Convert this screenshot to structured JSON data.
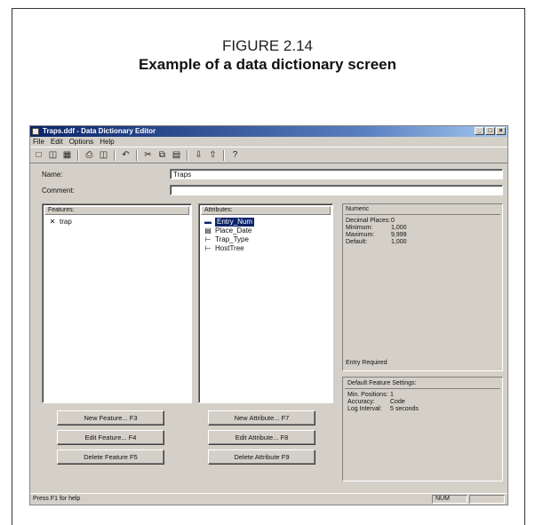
{
  "figure": {
    "number": "FIGURE 2.14",
    "title": "Example of a data dictionary screen"
  },
  "window": {
    "title": "Traps.ddf - Data Dictionary Editor",
    "controls": {
      "minimize": "_",
      "maximize": "□",
      "close": "×"
    }
  },
  "menu": [
    "File",
    "Edit",
    "Options",
    "Help"
  ],
  "toolbar": {
    "icons": [
      "new-file-icon",
      "open-folder-icon",
      "save-icon",
      "print-icon",
      "print-preview-icon",
      "undo-icon",
      "cut-icon",
      "copy-icon",
      "paste-icon",
      "move-down-icon",
      "move-up-icon",
      "help-icon"
    ]
  },
  "form": {
    "name_label": "Name:",
    "name_value": "Traps",
    "comment_label": "Comment:",
    "comment_value": ""
  },
  "features": {
    "header": "Features:",
    "items": [
      {
        "icon": "point-feature-icon",
        "label": "trap"
      }
    ]
  },
  "attributes": {
    "header": "Attributes:",
    "items": [
      {
        "icon": "numeric-attribute-icon",
        "label": "Entry_Num",
        "selected": true
      },
      {
        "icon": "date-attribute-icon",
        "label": "Place_Date",
        "selected": false
      },
      {
        "icon": "menu-attribute-icon",
        "label": "Trap_Type",
        "selected": false
      },
      {
        "icon": "menu-attribute-icon",
        "label": "HostTree",
        "selected": false
      }
    ]
  },
  "numeric": {
    "header": "Numeric",
    "rows": [
      {
        "key": "Decimal Places:",
        "value": "0"
      },
      {
        "key": "Minimum:",
        "value": "1,000"
      },
      {
        "key": "Maximum:",
        "value": "9,999"
      },
      {
        "key": "Default:",
        "value": "1,000"
      }
    ],
    "entry_required": "Entry Required"
  },
  "default_settings": {
    "header": "Default Feature Settings:",
    "rows": [
      {
        "key": "Min. Positions:",
        "value": "1"
      },
      {
        "key": "Accuracy:",
        "value": "Code"
      },
      {
        "key": "Log Interval:",
        "value": "5 seconds"
      }
    ]
  },
  "buttons": {
    "new_feature": "New Feature... F3",
    "edit_feature": "Edit Feature... F4",
    "delete_feature": "Delete Feature F5",
    "new_attribute": "New Attribute... F7",
    "edit_attribute": "Edit Attribute... F8",
    "delete_attribute": "Delete Attribute F9"
  },
  "statusbar": {
    "help_text": "Press F1 for help",
    "num": "NUM"
  }
}
